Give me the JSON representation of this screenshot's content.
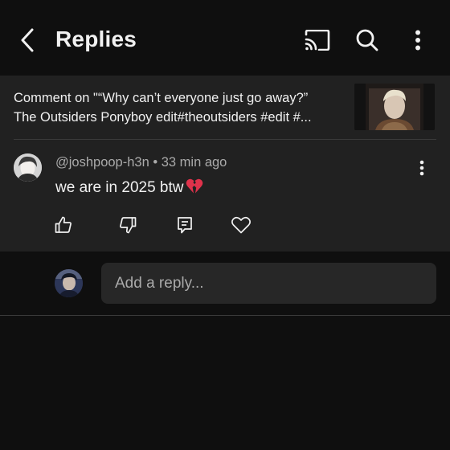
{
  "header": {
    "title": "Replies",
    "back_icon": "chevron-left-icon",
    "cast_icon": "cast-icon",
    "search_icon": "search-icon",
    "more_icon": "more-vertical-icon"
  },
  "context": {
    "line1": "Comment on \"“Why can’t everyone just go away?”",
    "line2": "The Outsiders Ponyboy edit#theoutsiders #edit #..."
  },
  "comment": {
    "author": "@joshpoop-h3n",
    "separator": "•",
    "time": "33 min ago",
    "text": "we are in 2025 btw",
    "emoji": "💔",
    "actions": [
      "thumbs-up-icon",
      "thumbs-down-icon",
      "reply-icon",
      "heart-icon"
    ]
  },
  "reply_box": {
    "placeholder": "Add a reply..."
  },
  "colors": {
    "background": "#0f0f0f",
    "surface": "#212121",
    "input": "#272727",
    "text_primary": "#f1f1f1",
    "text_secondary": "#aaaaaa",
    "broken_heart": "#e0324b"
  }
}
